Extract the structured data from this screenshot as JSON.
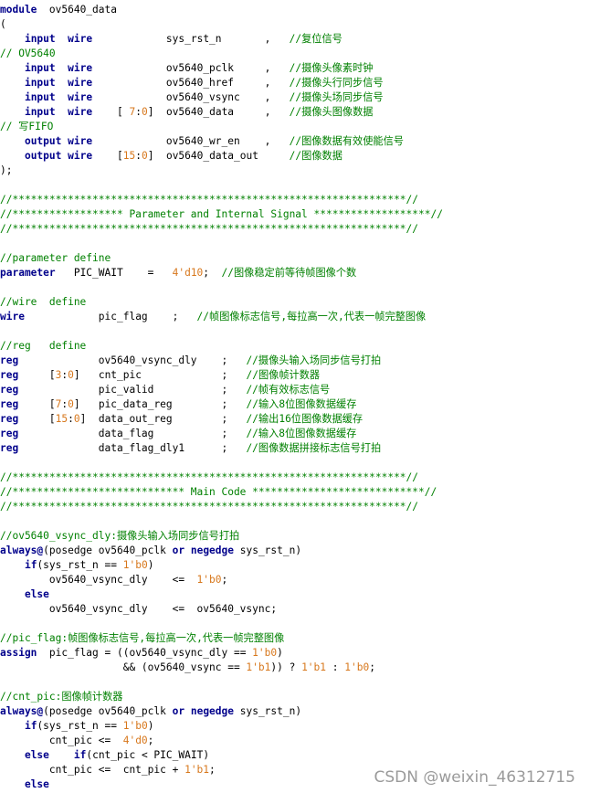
{
  "colors": {
    "keyword": "#00008b",
    "comment": "#008000",
    "number": "#d7771c",
    "identifier": "#000000",
    "background": "#ffffff",
    "watermark": "#9a9a9a"
  },
  "code_lines": [
    [
      [
        "kw",
        "module"
      ],
      [
        "id",
        "  ov5640_data"
      ]
    ],
    [
      [
        "pn",
        "("
      ]
    ],
    [
      [
        "id",
        "    "
      ],
      [
        "kw",
        "input"
      ],
      [
        "id",
        "  "
      ],
      [
        "kw",
        "wire"
      ],
      [
        "id",
        "            sys_rst_n       ,   "
      ],
      [
        "cm",
        "//复位信号"
      ]
    ],
    [
      [
        "cm",
        "// OV5640"
      ]
    ],
    [
      [
        "id",
        "    "
      ],
      [
        "kw",
        "input"
      ],
      [
        "id",
        "  "
      ],
      [
        "kw",
        "wire"
      ],
      [
        "id",
        "            ov5640_pclk     ,   "
      ],
      [
        "cm",
        "//摄像头像素时钟"
      ]
    ],
    [
      [
        "id",
        "    "
      ],
      [
        "kw",
        "input"
      ],
      [
        "id",
        "  "
      ],
      [
        "kw",
        "wire"
      ],
      [
        "id",
        "            ov5640_href     ,   "
      ],
      [
        "cm",
        "//摄像头行同步信号"
      ]
    ],
    [
      [
        "id",
        "    "
      ],
      [
        "kw",
        "input"
      ],
      [
        "id",
        "  "
      ],
      [
        "kw",
        "wire"
      ],
      [
        "id",
        "            ov5640_vsync    ,   "
      ],
      [
        "cm",
        "//摄像头场同步信号"
      ]
    ],
    [
      [
        "id",
        "    "
      ],
      [
        "kw",
        "input"
      ],
      [
        "id",
        "  "
      ],
      [
        "kw",
        "wire"
      ],
      [
        "id",
        "    [ "
      ],
      [
        "num",
        "7"
      ],
      [
        "id",
        ":"
      ],
      [
        "num",
        "0"
      ],
      [
        "id",
        "]  ov5640_data     ,   "
      ],
      [
        "cm",
        "//摄像头图像数据"
      ]
    ],
    [
      [
        "cm",
        "// 写FIFO"
      ]
    ],
    [
      [
        "id",
        "    "
      ],
      [
        "kw",
        "output"
      ],
      [
        "id",
        " "
      ],
      [
        "kw",
        "wire"
      ],
      [
        "id",
        "            ov5640_wr_en    ,   "
      ],
      [
        "cm",
        "//图像数据有效使能信号"
      ]
    ],
    [
      [
        "id",
        "    "
      ],
      [
        "kw",
        "output"
      ],
      [
        "id",
        " "
      ],
      [
        "kw",
        "wire"
      ],
      [
        "id",
        "    ["
      ],
      [
        "num",
        "15"
      ],
      [
        "id",
        ":"
      ],
      [
        "num",
        "0"
      ],
      [
        "id",
        "]  ov5640_data_out     "
      ],
      [
        "cm",
        "//图像数据"
      ]
    ],
    [
      [
        "pn",
        ");"
      ]
    ],
    [],
    [
      [
        "cm",
        "//****************************************************************//"
      ]
    ],
    [
      [
        "cm",
        "//****************** Parameter and Internal Signal *******************//"
      ]
    ],
    [
      [
        "cm",
        "//****************************************************************//"
      ]
    ],
    [],
    [
      [
        "cm",
        "//parameter define"
      ]
    ],
    [
      [
        "kw",
        "parameter"
      ],
      [
        "id",
        "   PIC_WAIT    =   "
      ],
      [
        "num",
        "4'd10"
      ],
      [
        "id",
        ";  "
      ],
      [
        "cm",
        "//图像稳定前等待帧图像个数"
      ]
    ],
    [],
    [
      [
        "cm",
        "//wire  define"
      ]
    ],
    [
      [
        "kw",
        "wire"
      ],
      [
        "id",
        "            pic_flag    ;   "
      ],
      [
        "cm",
        "//帧图像标志信号,每拉高一次,代表一帧完整图像"
      ]
    ],
    [],
    [
      [
        "cm",
        "//reg   define"
      ]
    ],
    [
      [
        "kw",
        "reg"
      ],
      [
        "id",
        "             ov5640_vsync_dly    ;   "
      ],
      [
        "cm",
        "//摄像头输入场同步信号打拍"
      ]
    ],
    [
      [
        "kw",
        "reg"
      ],
      [
        "id",
        "     ["
      ],
      [
        "num",
        "3"
      ],
      [
        "id",
        ":"
      ],
      [
        "num",
        "0"
      ],
      [
        "id",
        "]   cnt_pic             ;   "
      ],
      [
        "cm",
        "//图像帧计数器"
      ]
    ],
    [
      [
        "kw",
        "reg"
      ],
      [
        "id",
        "             pic_valid           ;   "
      ],
      [
        "cm",
        "//帧有效标志信号"
      ]
    ],
    [
      [
        "kw",
        "reg"
      ],
      [
        "id",
        "     ["
      ],
      [
        "num",
        "7"
      ],
      [
        "id",
        ":"
      ],
      [
        "num",
        "0"
      ],
      [
        "id",
        "]   pic_data_reg        ;   "
      ],
      [
        "cm",
        "//输入8位图像数据缓存"
      ]
    ],
    [
      [
        "kw",
        "reg"
      ],
      [
        "id",
        "     ["
      ],
      [
        "num",
        "15"
      ],
      [
        "id",
        ":"
      ],
      [
        "num",
        "0"
      ],
      [
        "id",
        "]  data_out_reg        ;   "
      ],
      [
        "cm",
        "//输出16位图像数据缓存"
      ]
    ],
    [
      [
        "kw",
        "reg"
      ],
      [
        "id",
        "             data_flag           ;   "
      ],
      [
        "cm",
        "//输入8位图像数据缓存"
      ]
    ],
    [
      [
        "kw",
        "reg"
      ],
      [
        "id",
        "             data_flag_dly1      ;   "
      ],
      [
        "cm",
        "//图像数据拼接标志信号打拍"
      ]
    ],
    [],
    [
      [
        "cm",
        "//****************************************************************//"
      ]
    ],
    [
      [
        "cm",
        "//**************************** Main Code ****************************//"
      ]
    ],
    [
      [
        "cm",
        "//****************************************************************//"
      ]
    ],
    [],
    [
      [
        "cm",
        "//ov5640_vsync_dly:摄像头输入场同步信号打拍"
      ]
    ],
    [
      [
        "kw",
        "always@"
      ],
      [
        "id",
        "(posedge ov5640_pclk "
      ],
      [
        "kw",
        "or"
      ],
      [
        "id",
        " "
      ],
      [
        "kw",
        "negedge"
      ],
      [
        "id",
        " sys_rst_n)"
      ]
    ],
    [
      [
        "id",
        "    "
      ],
      [
        "kw",
        "if"
      ],
      [
        "id",
        "(sys_rst_n == "
      ],
      [
        "num",
        "1'b0"
      ],
      [
        "id",
        ")"
      ]
    ],
    [
      [
        "id",
        "        ov5640_vsync_dly    <=  "
      ],
      [
        "num",
        "1'b0"
      ],
      [
        "id",
        ";"
      ]
    ],
    [
      [
        "id",
        "    "
      ],
      [
        "kw",
        "else"
      ]
    ],
    [
      [
        "id",
        "        ov5640_vsync_dly    <=  ov5640_vsync;"
      ]
    ],
    [],
    [
      [
        "cm",
        "//pic_flag:帧图像标志信号,每拉高一次,代表一帧完整图像"
      ]
    ],
    [
      [
        "kw",
        "assign"
      ],
      [
        "id",
        "  pic_flag = ((ov5640_vsync_dly == "
      ],
      [
        "num",
        "1'b0"
      ],
      [
        "id",
        ")"
      ]
    ],
    [
      [
        "id",
        "                    && (ov5640_vsync == "
      ],
      [
        "num",
        "1'b1"
      ],
      [
        "id",
        ")) ? "
      ],
      [
        "num",
        "1'b1"
      ],
      [
        "id",
        " : "
      ],
      [
        "num",
        "1'b0"
      ],
      [
        "id",
        ";"
      ]
    ],
    [],
    [
      [
        "cm",
        "//cnt_pic:图像帧计数器"
      ]
    ],
    [
      [
        "kw",
        "always@"
      ],
      [
        "id",
        "(posedge ov5640_pclk "
      ],
      [
        "kw",
        "or"
      ],
      [
        "id",
        " "
      ],
      [
        "kw",
        "negedge"
      ],
      [
        "id",
        " sys_rst_n)"
      ]
    ],
    [
      [
        "id",
        "    "
      ],
      [
        "kw",
        "if"
      ],
      [
        "id",
        "(sys_rst_n == "
      ],
      [
        "num",
        "1'b0"
      ],
      [
        "id",
        ")"
      ]
    ],
    [
      [
        "id",
        "        cnt_pic <=  "
      ],
      [
        "num",
        "4'd0"
      ],
      [
        "id",
        ";"
      ]
    ],
    [
      [
        "id",
        "    "
      ],
      [
        "kw",
        "else"
      ],
      [
        "id",
        "    "
      ],
      [
        "kw",
        "if"
      ],
      [
        "id",
        "(cnt_pic < PIC_WAIT)"
      ]
    ],
    [
      [
        "id",
        "        cnt_pic <=  cnt_pic + "
      ],
      [
        "num",
        "1'b1"
      ],
      [
        "id",
        ";"
      ]
    ],
    [
      [
        "id",
        "    "
      ],
      [
        "kw",
        "else"
      ]
    ]
  ],
  "watermark": "CSDN @weixin_46312715"
}
